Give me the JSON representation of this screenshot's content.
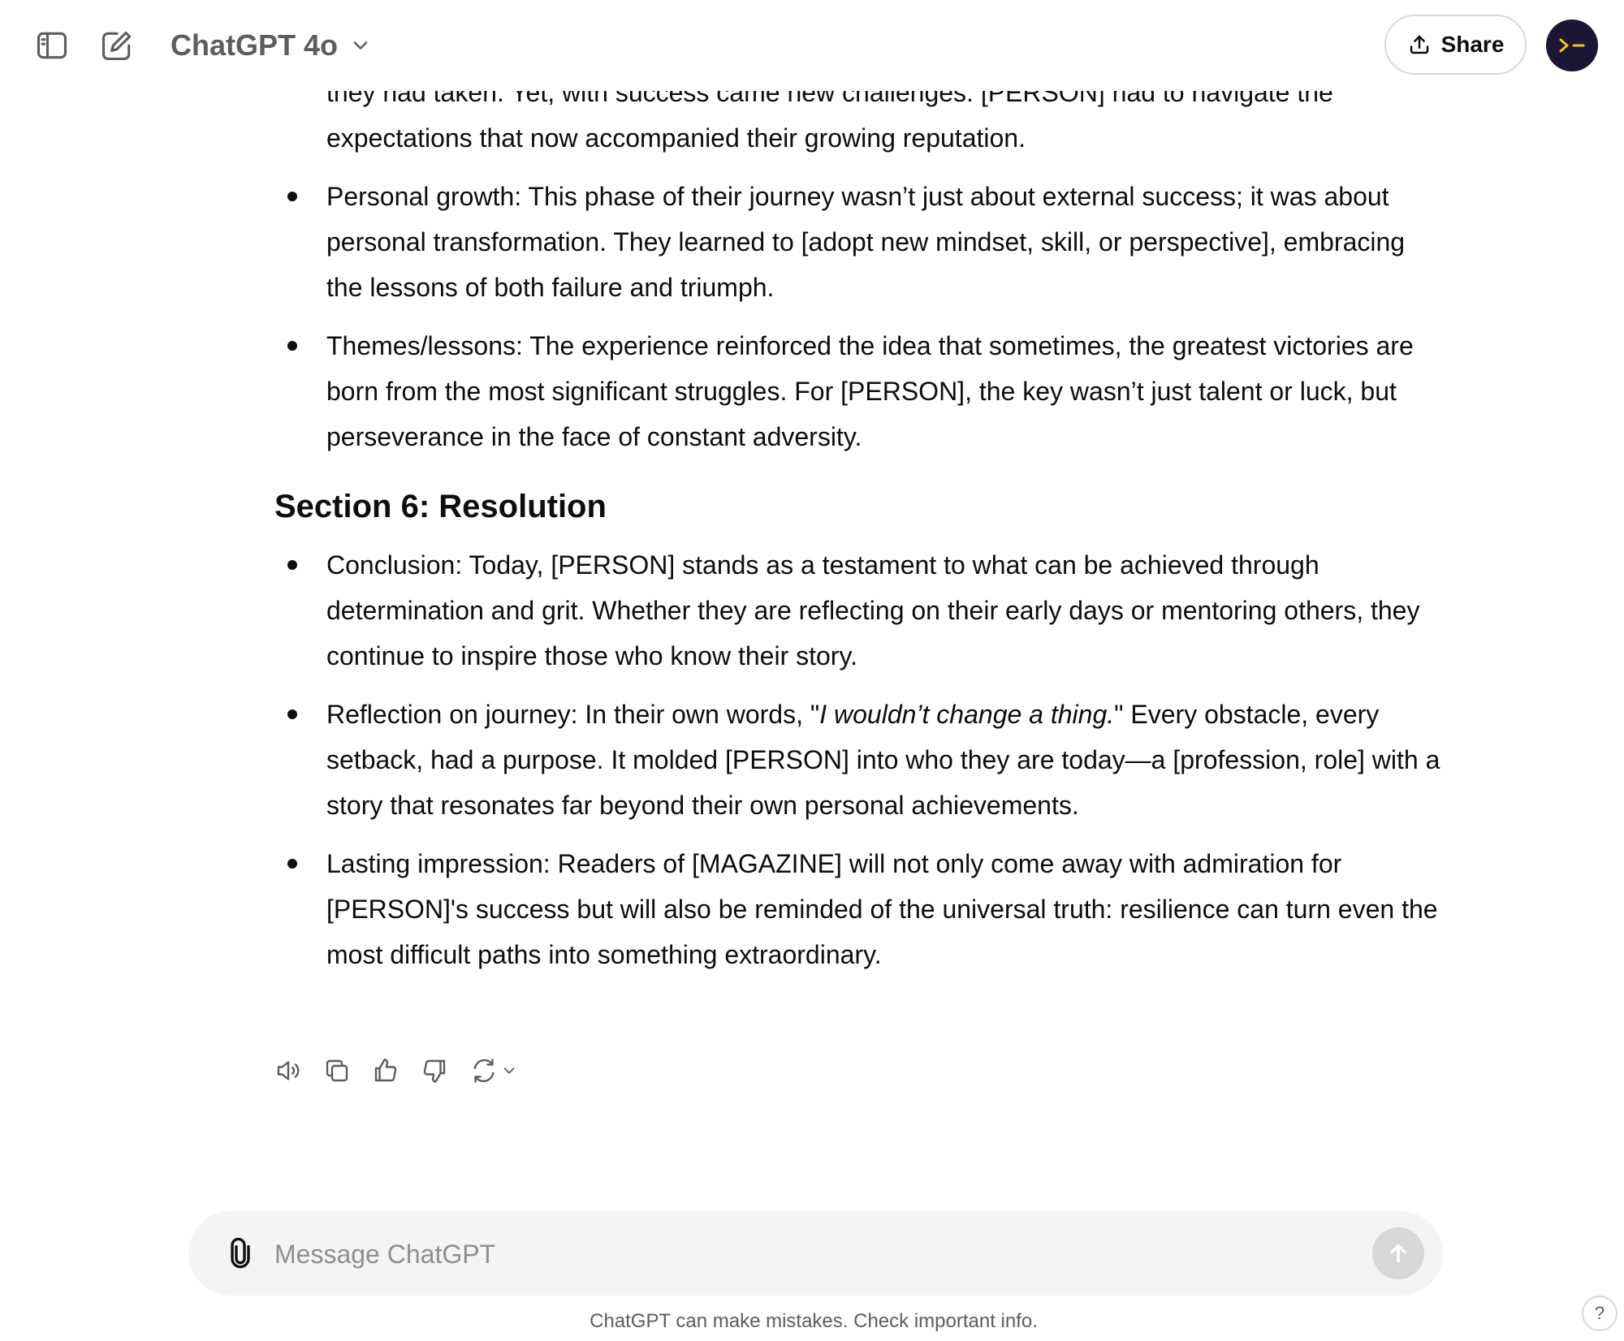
{
  "header": {
    "model_name": "ChatGPT 4o",
    "share_label": "Share",
    "icons": [
      "sidebar-toggle-icon",
      "new-chat-icon",
      "chevron-down-icon",
      "share-icon",
      "avatar-terminal-icon"
    ]
  },
  "message": {
    "partial_top_line": "they had taken. Yet, with success came new challenges: [PERSON] had to navigate the expectations that now accompanied their growing reputation.",
    "section5_items": [
      "Personal growth: This phase of their journey wasn’t just about external success; it was about personal transformation. They learned to [adopt new mindset, skill, or perspective], embracing the lessons of both failure and triumph.",
      "Themes/lessons: The experience reinforced the idea that sometimes, the greatest victories are born from the most significant struggles. For [PERSON], the key wasn’t just talent or luck, but perseverance in the face of constant adversity."
    ],
    "section6_heading": "Section 6: Resolution",
    "section6_conclusion": "Conclusion: Today, [PERSON] stands as a testament to what can be achieved through determination and grit. Whether they are reflecting on their early days or mentoring others, they continue to inspire those who know their story.",
    "section6_reflection": {
      "prefix": "Reflection on journey: In their own words, \"",
      "quote": "I wouldn’t change a thing.",
      "suffix": "\" Every obstacle, every setback, had a purpose. It molded [PERSON] into who they are today—a [profession, role] with a story that resonates far beyond their own personal achievements."
    },
    "section6_lasting": "Lasting impression: Readers of [MAGAZINE] will not only come away with admiration for [PERSON]'s success but will also be reminded of the universal truth: resilience can turn even the most difficult paths into something extraordinary."
  },
  "actions": {
    "icons": [
      "read-aloud-icon",
      "copy-icon",
      "thumbs-up-icon",
      "thumbs-down-icon",
      "regenerate-icon"
    ]
  },
  "composer": {
    "placeholder": "Message ChatGPT",
    "value": ""
  },
  "footer": {
    "disclaimer": "ChatGPT can make mistakes. Check important info.",
    "help_label": "?"
  },
  "colors": {
    "text": "#0d0d0d",
    "muted": "#5d5d5d",
    "composer_bg": "#f4f4f4",
    "send_disabled": "#d7d7d7",
    "avatar_bg": "#1b1634",
    "avatar_fg": "#f5c518"
  }
}
